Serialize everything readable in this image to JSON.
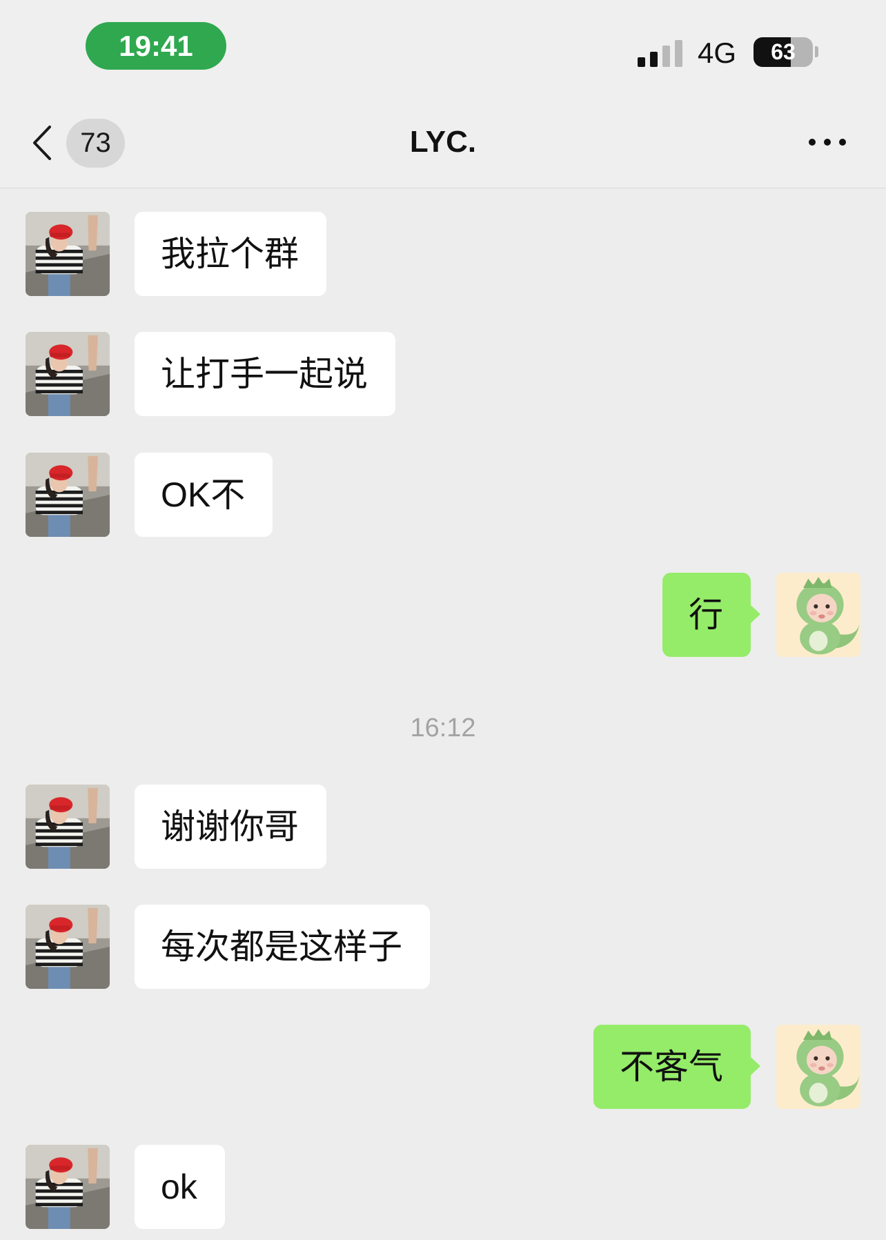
{
  "status_bar": {
    "time": "19:41",
    "network": "4G",
    "battery_percent": "63",
    "signal_level": 2,
    "signal_max": 4
  },
  "nav": {
    "back_icon": "chevron-left-icon",
    "unread_count": "73",
    "title": "LYC.",
    "more_icon": "more-icon"
  },
  "avatars": {
    "contact": "person-photo-avatar",
    "self": "dinosaur-avatar"
  },
  "colors": {
    "background": "#ededed",
    "incoming_bubble": "#ffffff",
    "outgoing_bubble": "#95ec69",
    "time_pill": "#2fa84f"
  },
  "chat": {
    "time_divider": "16:12"
  },
  "messages": [
    {
      "sender": "contact",
      "text": "我拉个群"
    },
    {
      "sender": "contact",
      "text": "让打手一起说"
    },
    {
      "sender": "contact",
      "text": "OK不"
    },
    {
      "sender": "self",
      "text": "行"
    },
    {
      "sender": "contact",
      "text": "谢谢你哥"
    },
    {
      "sender": "contact",
      "text": "每次都是这样子"
    },
    {
      "sender": "self",
      "text": "不客气"
    },
    {
      "sender": "contact",
      "text": "ok"
    }
  ]
}
